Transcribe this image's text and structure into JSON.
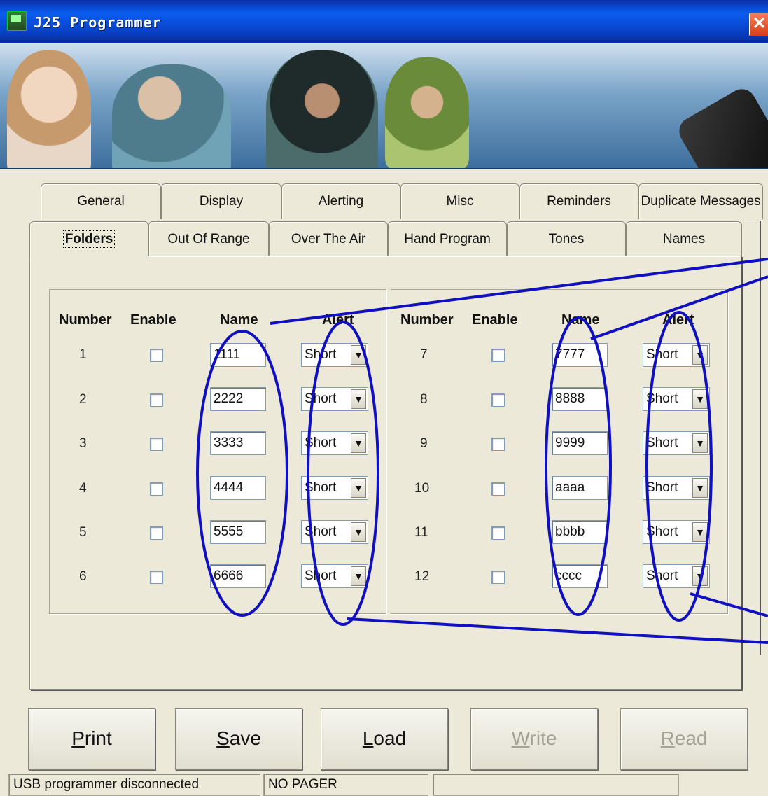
{
  "window": {
    "title": "J25 Programmer",
    "close_glyph": "✕"
  },
  "tabs_back": [
    "General",
    "Display",
    "Alerting",
    "Misc",
    "Reminders",
    "Duplicate Messages"
  ],
  "tabs_front": [
    "Folders",
    "Out Of Range",
    "Over The Air",
    "Hand Program",
    "Tones",
    "Names"
  ],
  "active_tab": "Folders",
  "folders": {
    "headers": {
      "number": "Number",
      "enable": "Enable",
      "name": "Name",
      "alert": "Alert"
    },
    "left": [
      {
        "number": "1",
        "enabled": false,
        "name": "1111",
        "alert": "Short"
      },
      {
        "number": "2",
        "enabled": false,
        "name": "2222",
        "alert": "Short"
      },
      {
        "number": "3",
        "enabled": false,
        "name": "3333",
        "alert": "Short"
      },
      {
        "number": "4",
        "enabled": false,
        "name": "4444",
        "alert": "Short"
      },
      {
        "number": "5",
        "enabled": false,
        "name": "5555",
        "alert": "Short"
      },
      {
        "number": "6",
        "enabled": false,
        "name": "6666",
        "alert": "Short"
      }
    ],
    "right": [
      {
        "number": "7",
        "enabled": false,
        "name": "7777",
        "alert": "Short"
      },
      {
        "number": "8",
        "enabled": false,
        "name": "8888",
        "alert": "Short"
      },
      {
        "number": "9",
        "enabled": false,
        "name": "9999",
        "alert": "Short"
      },
      {
        "number": "10",
        "enabled": false,
        "name": "aaaa",
        "alert": "Short"
      },
      {
        "number": "11",
        "enabled": false,
        "name": "bbbb",
        "alert": "Short"
      },
      {
        "number": "12",
        "enabled": false,
        "name": "cccc",
        "alert": "Short"
      }
    ]
  },
  "buttons": {
    "print": {
      "accel": "P",
      "rest": "rint"
    },
    "save": {
      "accel": "S",
      "rest": "ave"
    },
    "load": {
      "accel": "L",
      "rest": "oad"
    },
    "write": {
      "accel": "W",
      "rest": "rite"
    },
    "read": {
      "accel": "R",
      "rest": "ead"
    }
  },
  "status": {
    "connection": "USB programmer disconnected",
    "pager": "NO PAGER",
    "extra": ""
  },
  "colors": {
    "annotation": "#1010c0",
    "titlebar": "#0b5df0",
    "face": "#ece9d8"
  },
  "icons": {
    "app": "pager-icon",
    "dropdown": "chevron-down-icon"
  }
}
